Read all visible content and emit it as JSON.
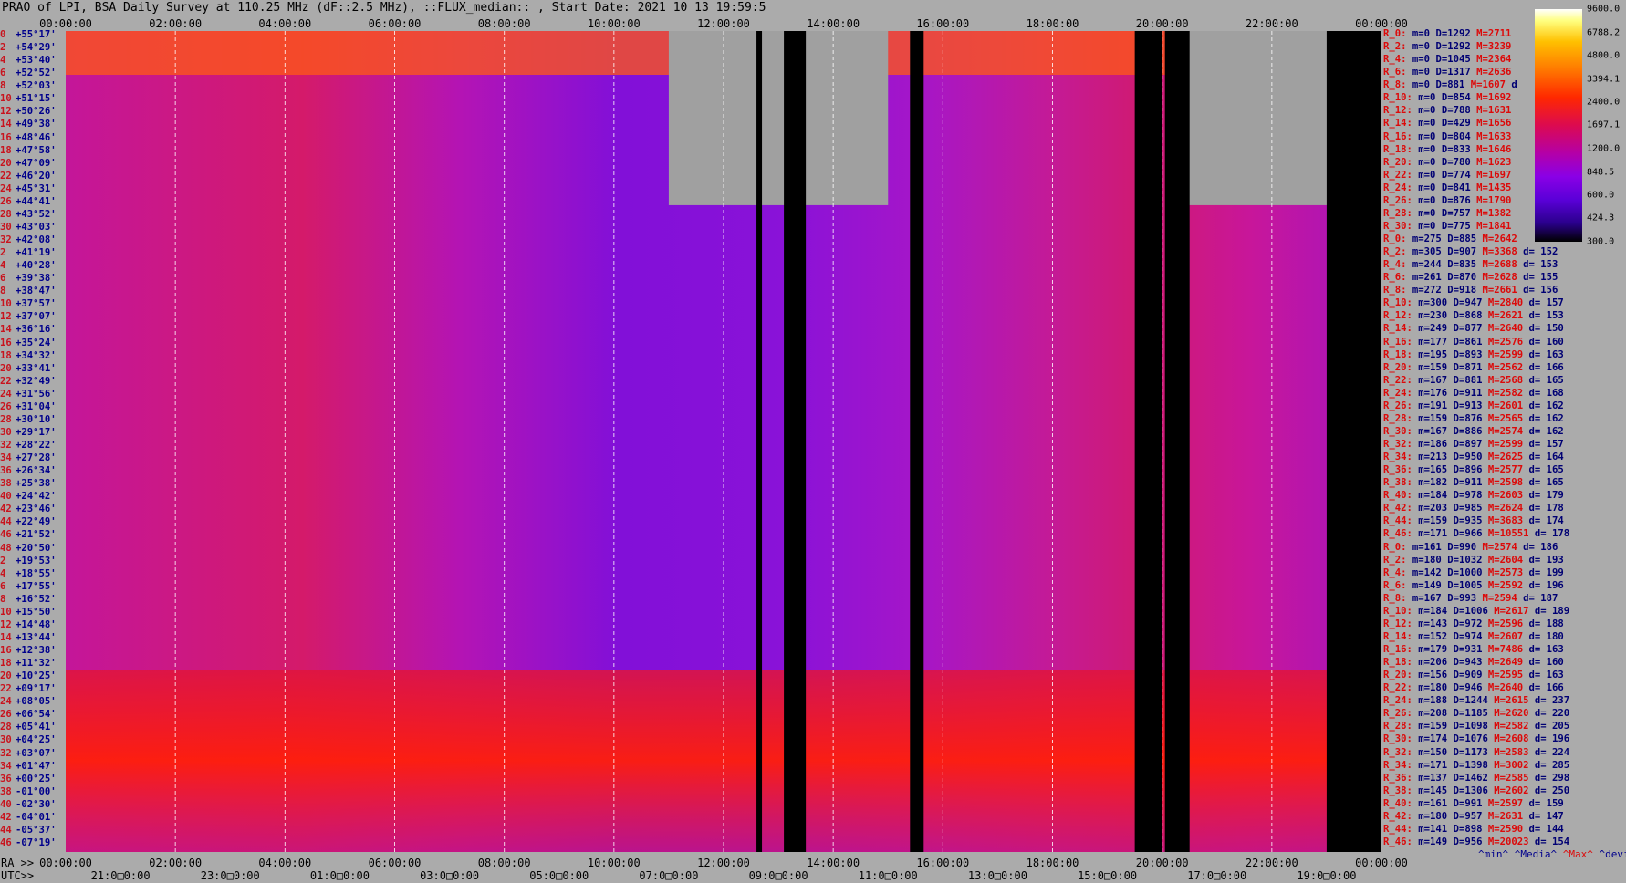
{
  "title": "PRAO of LPI, BSA Daily Survey at 110.25 MHz (dF::2.5 MHz), ::FLUX_median:: , Start Date: 2021 10 13 19:59:5",
  "top_axis_ticks": [
    "00:00:00",
    "02:00:00",
    "04:00:00",
    "06:00:00",
    "08:00:00",
    "10:00:00",
    "12:00:00",
    "14:00:00",
    "16:00:00",
    "18:00:00",
    "20:00:00",
    "22:00:00",
    "00:00:00"
  ],
  "ra_axis": {
    "prefix": "RA >>",
    "ticks": [
      "00:00:00",
      "02:00:00",
      "04:00:00",
      "06:00:00",
      "08:00:00",
      "10:00:00",
      "12:00:00",
      "14:00:00",
      "16:00:00",
      "18:00:00",
      "20:00:00",
      "22:00:00",
      "00:00:00"
    ]
  },
  "utc_axis": {
    "prefix": "UTC>>",
    "ticks": [
      "21:0□0:00",
      "23:0□0:00",
      "01:0□0:00",
      "03:0□0:00",
      "05:0□0:00",
      "07:0□0:00",
      "09:0□0:00",
      "11:0□0:00",
      "13:0□0:00",
      "15:0□0:00",
      "17:0□0:00",
      "19:0□0:00"
    ]
  },
  "dec_labels": [
    {
      "idx": "0",
      "dec": "+55°17'"
    },
    {
      "idx": "2",
      "dec": "+54°29'"
    },
    {
      "idx": "4",
      "dec": "+53°40'"
    },
    {
      "idx": "6",
      "dec": "+52°52'"
    },
    {
      "idx": "8",
      "dec": "+52°03'"
    },
    {
      "idx": "10",
      "dec": "+51°15'"
    },
    {
      "idx": "12",
      "dec": "+50°26'"
    },
    {
      "idx": "14",
      "dec": "+49°38'"
    },
    {
      "idx": "16",
      "dec": "+48°46'"
    },
    {
      "idx": "18",
      "dec": "+47°58'"
    },
    {
      "idx": "20",
      "dec": "+47°09'"
    },
    {
      "idx": "22",
      "dec": "+46°20'"
    },
    {
      "idx": "24",
      "dec": "+45°31'"
    },
    {
      "idx": "26",
      "dec": "+44°41'"
    },
    {
      "idx": "28",
      "dec": "+43°52'"
    },
    {
      "idx": "30",
      "dec": "+43°03'"
    },
    {
      "idx": "32",
      "dec": "+42°08'"
    },
    {
      "idx": "2",
      "dec": "+41°19'"
    },
    {
      "idx": "4",
      "dec": "+40°28'"
    },
    {
      "idx": "6",
      "dec": "+39°38'"
    },
    {
      "idx": "8",
      "dec": "+38°47'"
    },
    {
      "idx": "10",
      "dec": "+37°57'"
    },
    {
      "idx": "12",
      "dec": "+37°07'"
    },
    {
      "idx": "14",
      "dec": "+36°16'"
    },
    {
      "idx": "16",
      "dec": "+35°24'"
    },
    {
      "idx": "18",
      "dec": "+34°32'"
    },
    {
      "idx": "20",
      "dec": "+33°41'"
    },
    {
      "idx": "22",
      "dec": "+32°49'"
    },
    {
      "idx": "24",
      "dec": "+31°56'"
    },
    {
      "idx": "26",
      "dec": "+31°04'"
    },
    {
      "idx": "28",
      "dec": "+30°10'"
    },
    {
      "idx": "30",
      "dec": "+29°17'"
    },
    {
      "idx": "32",
      "dec": "+28°22'"
    },
    {
      "idx": "34",
      "dec": "+27°28'"
    },
    {
      "idx": "36",
      "dec": "+26°34'"
    },
    {
      "idx": "38",
      "dec": "+25°38'"
    },
    {
      "idx": "40",
      "dec": "+24°42'"
    },
    {
      "idx": "42",
      "dec": "+23°46'"
    },
    {
      "idx": "44",
      "dec": "+22°49'"
    },
    {
      "idx": "46",
      "dec": "+21°52'"
    },
    {
      "idx": "48",
      "dec": "+20°50'"
    },
    {
      "idx": "2",
      "dec": "+19°53'"
    },
    {
      "idx": "4",
      "dec": "+18°55'"
    },
    {
      "idx": "6",
      "dec": "+17°55'"
    },
    {
      "idx": "8",
      "dec": "+16°52'"
    },
    {
      "idx": "10",
      "dec": "+15°50'"
    },
    {
      "idx": "12",
      "dec": "+14°48'"
    },
    {
      "idx": "14",
      "dec": "+13°44'"
    },
    {
      "idx": "16",
      "dec": "+12°38'"
    },
    {
      "idx": "18",
      "dec": "+11°32'"
    },
    {
      "idx": "20",
      "dec": "+10°25'"
    },
    {
      "idx": "22",
      "dec": "+09°17'"
    },
    {
      "idx": "24",
      "dec": "+08°05'"
    },
    {
      "idx": "26",
      "dec": "+06°54'"
    },
    {
      "idx": "28",
      "dec": "+05°41'"
    },
    {
      "idx": "30",
      "dec": "+04°25'"
    },
    {
      "idx": "32",
      "dec": "+03°07'"
    },
    {
      "idx": "34",
      "dec": "+01°47'"
    },
    {
      "idx": "36",
      "dec": "+00°25'"
    },
    {
      "idx": "38",
      "dec": "-01°00'"
    },
    {
      "idx": "40",
      "dec": "-02°30'"
    },
    {
      "idx": "42",
      "dec": "-04°01'"
    },
    {
      "idx": "44",
      "dec": "-05°37'"
    },
    {
      "idx": "46",
      "dec": "-07°19'"
    }
  ],
  "stats_rows": [
    {
      "key": "R_0:",
      "min": "m=0",
      "med": "D=1292",
      "max": "M=2711",
      "dev": ""
    },
    {
      "key": "R_2:",
      "min": "m=0",
      "med": "D=1292",
      "max": "M=3239",
      "dev": ""
    },
    {
      "key": "R_4:",
      "min": "m=0",
      "med": "D=1045",
      "max": "M=2364",
      "dev": ""
    },
    {
      "key": "R_6:",
      "min": "m=0",
      "med": "D=1317",
      "max": "M=2636",
      "dev": ""
    },
    {
      "key": "R_8:",
      "min": "m=0",
      "med": "D=881",
      "max": "M=1607",
      "dev": "d"
    },
    {
      "key": "R_10:",
      "min": "m=0",
      "med": "D=854",
      "max": "M=1692",
      "dev": ""
    },
    {
      "key": "R_12:",
      "min": "m=0",
      "med": "D=788",
      "max": "M=1631",
      "dev": ""
    },
    {
      "key": "R_14:",
      "min": "m=0",
      "med": "D=429",
      "max": "M=1656",
      "dev": ""
    },
    {
      "key": "R_16:",
      "min": "m=0",
      "med": "D=804",
      "max": "M=1633",
      "dev": ""
    },
    {
      "key": "R_18:",
      "min": "m=0",
      "med": "D=833",
      "max": "M=1646",
      "dev": ""
    },
    {
      "key": "R_20:",
      "min": "m=0",
      "med": "D=780",
      "max": "M=1623",
      "dev": ""
    },
    {
      "key": "R_22:",
      "min": "m=0",
      "med": "D=774",
      "max": "M=1697",
      "dev": ""
    },
    {
      "key": "R_24:",
      "min": "m=0",
      "med": "D=841",
      "max": "M=1435",
      "dev": ""
    },
    {
      "key": "R_26:",
      "min": "m=0",
      "med": "D=876",
      "max": "M=1790",
      "dev": ""
    },
    {
      "key": "R_28:",
      "min": "m=0",
      "med": "D=757",
      "max": "M=1382",
      "dev": ""
    },
    {
      "key": "R_30:",
      "min": "m=0",
      "med": "D=775",
      "max": "M=1841",
      "dev": ""
    },
    {
      "key": "R_0:",
      "min": "m=275",
      "med": "D=885",
      "max": "M=2642",
      "dev": ""
    },
    {
      "key": "R_2:",
      "min": "m=305",
      "med": "D=907",
      "max": "M=3368",
      "dev": "d= 152"
    },
    {
      "key": "R_4:",
      "min": "m=244",
      "med": "D=835",
      "max": "M=2688",
      "dev": "d= 153"
    },
    {
      "key": "R_6:",
      "min": "m=261",
      "med": "D=870",
      "max": "M=2628",
      "dev": "d= 155"
    },
    {
      "key": "R_8:",
      "min": "m=272",
      "med": "D=918",
      "max": "M=2661",
      "dev": "d= 156"
    },
    {
      "key": "R_10:",
      "min": "m=300",
      "med": "D=947",
      "max": "M=2840",
      "dev": "d= 157"
    },
    {
      "key": "R_12:",
      "min": "m=230",
      "med": "D=868",
      "max": "M=2621",
      "dev": "d= 153"
    },
    {
      "key": "R_14:",
      "min": "m=249",
      "med": "D=877",
      "max": "M=2640",
      "dev": "d= 150"
    },
    {
      "key": "R_16:",
      "min": "m=177",
      "med": "D=861",
      "max": "M=2576",
      "dev": "d= 160"
    },
    {
      "key": "R_18:",
      "min": "m=195",
      "med": "D=893",
      "max": "M=2599",
      "dev": "d= 163"
    },
    {
      "key": "R_20:",
      "min": "m=159",
      "med": "D=871",
      "max": "M=2562",
      "dev": "d= 166"
    },
    {
      "key": "R_22:",
      "min": "m=167",
      "med": "D=881",
      "max": "M=2568",
      "dev": "d= 165"
    },
    {
      "key": "R_24:",
      "min": "m=176",
      "med": "D=911",
      "max": "M=2582",
      "dev": "d= 168"
    },
    {
      "key": "R_26:",
      "min": "m=191",
      "med": "D=913",
      "max": "M=2601",
      "dev": "d= 162"
    },
    {
      "key": "R_28:",
      "min": "m=159",
      "med": "D=876",
      "max": "M=2565",
      "dev": "d= 162"
    },
    {
      "key": "R_30:",
      "min": "m=167",
      "med": "D=886",
      "max": "M=2574",
      "dev": "d= 162"
    },
    {
      "key": "R_32:",
      "min": "m=186",
      "med": "D=897",
      "max": "M=2599",
      "dev": "d= 157"
    },
    {
      "key": "R_34:",
      "min": "m=213",
      "med": "D=950",
      "max": "M=2625",
      "dev": "d= 164"
    },
    {
      "key": "R_36:",
      "min": "m=165",
      "med": "D=896",
      "max": "M=2577",
      "dev": "d= 165"
    },
    {
      "key": "R_38:",
      "min": "m=182",
      "med": "D=911",
      "max": "M=2598",
      "dev": "d= 165"
    },
    {
      "key": "R_40:",
      "min": "m=184",
      "med": "D=978",
      "max": "M=2603",
      "dev": "d= 179"
    },
    {
      "key": "R_42:",
      "min": "m=203",
      "med": "D=985",
      "max": "M=2624",
      "dev": "d= 178"
    },
    {
      "key": "R_44:",
      "min": "m=159",
      "med": "D=935",
      "max": "M=3683",
      "dev": "d= 174"
    },
    {
      "key": "R_46:",
      "min": "m=171",
      "med": "D=966",
      "max": "M=10551",
      "dev": "d= 178"
    },
    {
      "key": "R_0:",
      "min": "m=161",
      "med": "D=990",
      "max": "M=2574",
      "dev": "d= 186"
    },
    {
      "key": "R_2:",
      "min": "m=180",
      "med": "D=1032",
      "max": "M=2604",
      "dev": "d= 193"
    },
    {
      "key": "R_4:",
      "min": "m=142",
      "med": "D=1000",
      "max": "M=2573",
      "dev": "d= 199"
    },
    {
      "key": "R_6:",
      "min": "m=149",
      "med": "D=1005",
      "max": "M=2592",
      "dev": "d= 196"
    },
    {
      "key": "R_8:",
      "min": "m=167",
      "med": "D=993",
      "max": "M=2594",
      "dev": "d= 187"
    },
    {
      "key": "R_10:",
      "min": "m=184",
      "med": "D=1006",
      "max": "M=2617",
      "dev": "d= 189"
    },
    {
      "key": "R_12:",
      "min": "m=143",
      "med": "D=972",
      "max": "M=2596",
      "dev": "d= 188"
    },
    {
      "key": "R_14:",
      "min": "m=152",
      "med": "D=974",
      "max": "M=2607",
      "dev": "d= 180"
    },
    {
      "key": "R_16:",
      "min": "m=179",
      "med": "D=931",
      "max": "M=7486",
      "dev": "d= 163"
    },
    {
      "key": "R_18:",
      "min": "m=206",
      "med": "D=943",
      "max": "M=2649",
      "dev": "d= 160"
    },
    {
      "key": "R_20:",
      "min": "m=156",
      "med": "D=909",
      "max": "M=2595",
      "dev": "d= 163"
    },
    {
      "key": "R_22:",
      "min": "m=180",
      "med": "D=946",
      "max": "M=2640",
      "dev": "d= 166"
    },
    {
      "key": "R_24:",
      "min": "m=188",
      "med": "D=1244",
      "max": "M=2615",
      "dev": "d= 237"
    },
    {
      "key": "R_26:",
      "min": "m=208",
      "med": "D=1185",
      "max": "M=2620",
      "dev": "d= 220"
    },
    {
      "key": "R_28:",
      "min": "m=159",
      "med": "D=1098",
      "max": "M=2582",
      "dev": "d= 205"
    },
    {
      "key": "R_30:",
      "min": "m=174",
      "med": "D=1076",
      "max": "M=2608",
      "dev": "d= 196"
    },
    {
      "key": "R_32:",
      "min": "m=150",
      "med": "D=1173",
      "max": "M=2583",
      "dev": "d= 224"
    },
    {
      "key": "R_34:",
      "min": "m=171",
      "med": "D=1398",
      "max": "M=3002",
      "dev": "d= 285"
    },
    {
      "key": "R_36:",
      "min": "m=137",
      "med": "D=1462",
      "max": "M=2585",
      "dev": "d= 298"
    },
    {
      "key": "R_38:",
      "min": "m=145",
      "med": "D=1306",
      "max": "M=2602",
      "dev": "d= 250"
    },
    {
      "key": "R_40:",
      "min": "m=161",
      "med": "D=991",
      "max": "M=2597",
      "dev": "d= 159"
    },
    {
      "key": "R_42:",
      "min": "m=180",
      "med": "D=957",
      "max": "M=2631",
      "dev": "d= 147"
    },
    {
      "key": "R_44:",
      "min": "m=141",
      "med": "D=898",
      "max": "M=2590",
      "dev": "d= 144"
    },
    {
      "key": "R_46:",
      "min": "m=149",
      "med": "D=956",
      "max": "M=20023",
      "dev": "d= 154"
    }
  ],
  "stats_legend": {
    "min": "^min^",
    "med": "^Media^",
    "max": "^Max^",
    "dev": "^devia^"
  },
  "colorbar": {
    "labels": [
      "9600.0",
      "6788.2",
      "4800.0",
      "3394.1",
      "2400.0",
      "1697.1",
      "1200.0",
      "848.5",
      "600.0",
      "424.3",
      "300.0"
    ],
    "colors": [
      "#000000",
      "#5a00d8",
      "#b400a8",
      "#ff2800",
      "#ffc000",
      "#ffffff"
    ]
  },
  "chart_data": {
    "type": "heatmap",
    "title": "PRAO of LPI, BSA Daily Survey at 110.25 MHz (dF::2.5 MHz), ::FLUX_median:: , Start Date: 2021 10 13 19:59:5",
    "x_axis_ra_hours": [
      0,
      24
    ],
    "x_ticks_ra": [
      "00:00:00",
      "02:00:00",
      "04:00:00",
      "06:00:00",
      "08:00:00",
      "10:00:00",
      "12:00:00",
      "14:00:00",
      "16:00:00",
      "18:00:00",
      "20:00:00",
      "22:00:00",
      "00:00:00"
    ],
    "y_axis_declination_deg": [
      55.28,
      -7.32
    ],
    "color_scale": "log",
    "zlim": [
      300,
      9600
    ],
    "masked_regions_ra_hours": [
      {
        "ra": [
          11.0,
          15.0
        ],
        "dec": [
          55.28,
          42.0
        ],
        "fill": "gray"
      },
      {
        "ra": [
          20.1,
          25.0
        ],
        "dec": [
          55.28,
          42.0
        ],
        "fill": "gray"
      }
    ],
    "blank_columns_ra_hours": [
      [
        12.6,
        12.7
      ],
      [
        13.1,
        13.5
      ],
      [
        15.4,
        15.65
      ],
      [
        19.5,
        20.0
      ],
      [
        20.05,
        20.5
      ],
      [
        23.0,
        24.0
      ]
    ],
    "bright_band_dec_deg": [
      8.1,
      -7.3
    ],
    "bright_top_rows_dec_deg": [
      55.28,
      52.9
    ]
  }
}
